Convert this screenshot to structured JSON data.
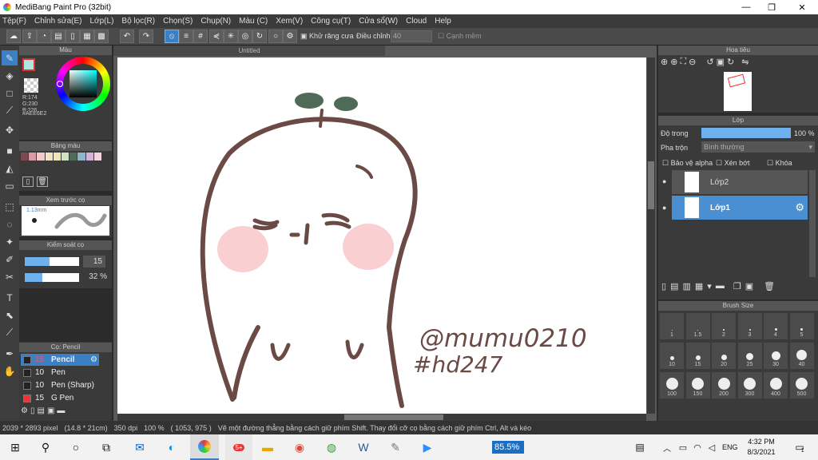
{
  "window": {
    "title": "MediBang Paint Pro (32bit)",
    "min": "—",
    "max": "❐",
    "close": "✕"
  },
  "menu": [
    "Tệp(F)",
    "Chỉnh sửa(E)",
    "Lớp(L)",
    "Bộ lọc(R)",
    "Chọn(S)",
    "Chụp(N)",
    "Màu (C)",
    "Xem(V)",
    "Công cụ(T)",
    "Cửa sổ(W)",
    "Cloud",
    "Help"
  ],
  "toolbar": {
    "antialias_label": "Khử răng cưa",
    "adjust_label": "Điều chỉnh",
    "adjust_value": "40",
    "edge_label": "Cạnh mềm"
  },
  "color_panel": {
    "title": "Màu",
    "r": "R:174",
    "g": "G:230",
    "b": "B:226",
    "hex": "#AEE6E2",
    "fg": "#aee6e2"
  },
  "palette": {
    "title": "Bảng màu",
    "swatches": [
      "#7a4a50",
      "#d89aa5",
      "#f3c9c9",
      "#f4e3c3",
      "#efe6b8",
      "#cfe3c0",
      "#4f6b57",
      "#8fb5c9",
      "#d3b4d8",
      "#f1d4de"
    ]
  },
  "brush_preview": {
    "title": "Xem trước cọ",
    "size": "1.13mm"
  },
  "brush_control": {
    "title": "Kiểm soát cọ",
    "size_value": "15",
    "size_frac": 0.46,
    "opacity_value": "32 %",
    "opacity_frac": 0.32
  },
  "brush_list": {
    "title": "Cọ: Pencil",
    "items": [
      {
        "size": "15",
        "name": "Pencil",
        "color": "#222"
      },
      {
        "size": "10",
        "name": "Pen",
        "color": "#222"
      },
      {
        "size": "10",
        "name": "Pen (Sharp)",
        "color": "#222"
      },
      {
        "size": "15",
        "name": "G Pen",
        "color": "#e33"
      }
    ]
  },
  "canvas": {
    "tab": "Untitled",
    "signature_line1": "@mumu0210",
    "signature_line2": "#hd247"
  },
  "navigator": {
    "title": "Hoa tiêu"
  },
  "layers": {
    "title": "Lớp",
    "opacity_label": "Độ trong",
    "opacity_value": "100 %",
    "opacity_frac": 1.0,
    "blend_label": "Pha trộn",
    "blend_value": "Bình thường",
    "protect_alpha": "Bảo vệ alpha",
    "clip": "Xén bớt",
    "lock": "Khóa",
    "items": [
      {
        "name": "Lớp2",
        "selected": false
      },
      {
        "name": "Lớp1",
        "selected": true
      }
    ]
  },
  "brush_size": {
    "title": "Brush Size",
    "sizes": [
      "1",
      "1.5",
      "2",
      "3",
      "4",
      "5",
      "10",
      "15",
      "20",
      "25",
      "30",
      "40",
      "100",
      "150",
      "200",
      "300",
      "400",
      "500"
    ]
  },
  "status": {
    "dims": "2039 * 2893 pixel",
    "cm": "(14.8 * 21cm)",
    "dpi": "350 dpi",
    "zoom": "100 %",
    "coords": "( 1053, 975 )",
    "hint": "Vẽ một đường thẳng bằng cách giữ phím Shift. Thay đổi cỡ cọ bằng cách giữ phím Ctrl, Alt và kéo"
  },
  "taskbar": {
    "zoom_box": "85.5%",
    "lang": "ENG",
    "time": "4:32 PM",
    "date": "8/3/2021",
    "notif": "1",
    "badge": "5+"
  },
  "colors": {
    "accent": "#3b7fc4",
    "layer_sel": "#4b8fd3",
    "ink": "#6b4a45",
    "cheek": "#f9cfd2",
    "sprout": "#4f6b57"
  }
}
